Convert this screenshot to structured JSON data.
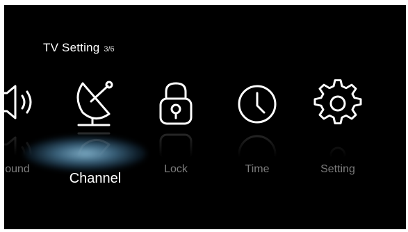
{
  "header": {
    "title": "TV Setting",
    "page_indicator": "3/6"
  },
  "menu": {
    "items": [
      {
        "label": "ound",
        "icon": "speaker-icon",
        "selected": false
      },
      {
        "label": "Channel",
        "icon": "satellite-dish-icon",
        "selected": true
      },
      {
        "label": "Lock",
        "icon": "padlock-icon",
        "selected": false
      },
      {
        "label": "Time",
        "icon": "clock-icon",
        "selected": false
      },
      {
        "label": "Setting",
        "icon": "gear-icon",
        "selected": false
      }
    ]
  },
  "colors": {
    "background": "#000000",
    "text_selected": "#ffffff",
    "text_unselected": "#7d7d7d",
    "glow": "#96cdeb"
  }
}
